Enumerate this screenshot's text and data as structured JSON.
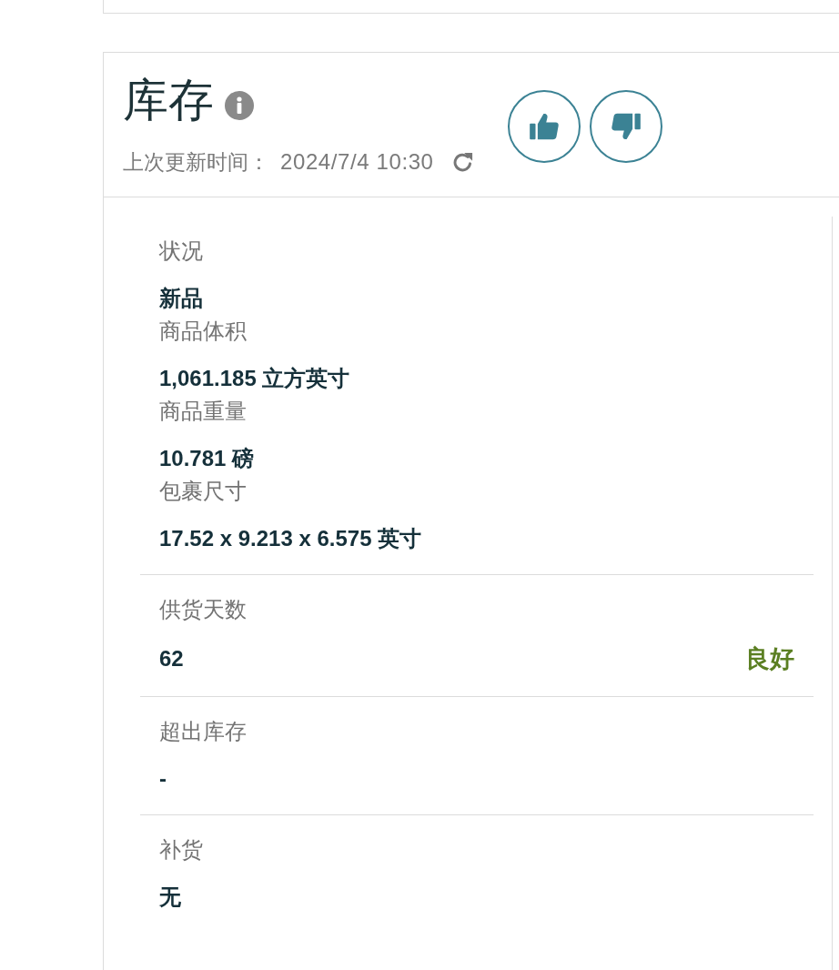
{
  "header": {
    "title": "库存",
    "last_updated_label": "上次更新时间：",
    "last_updated": "2024/7/4 10:30",
    "feedback_buttons": [
      {
        "kind": "thumbs_up",
        "selected": false
      },
      {
        "kind": "thumbs_down",
        "selected": false
      }
    ]
  },
  "sections": [
    {
      "fields": [
        {
          "label": "状况",
          "value": "新品"
        },
        {
          "label": "商品体积",
          "value": "1,061.185 立方英寸"
        },
        {
          "label": "商品重量",
          "value": "10.781 磅"
        },
        {
          "label": "包裹尺寸",
          "value": "17.52 x 9.213 x 6.575 英寸"
        }
      ]
    },
    {
      "fields": [
        {
          "label": "供货天数",
          "value": "62",
          "status": "良好"
        }
      ]
    },
    {
      "fields": [
        {
          "label": "超出库存",
          "value": "-"
        }
      ]
    },
    {
      "fields": [
        {
          "label": "补货",
          "value": "无"
        }
      ]
    }
  ]
}
